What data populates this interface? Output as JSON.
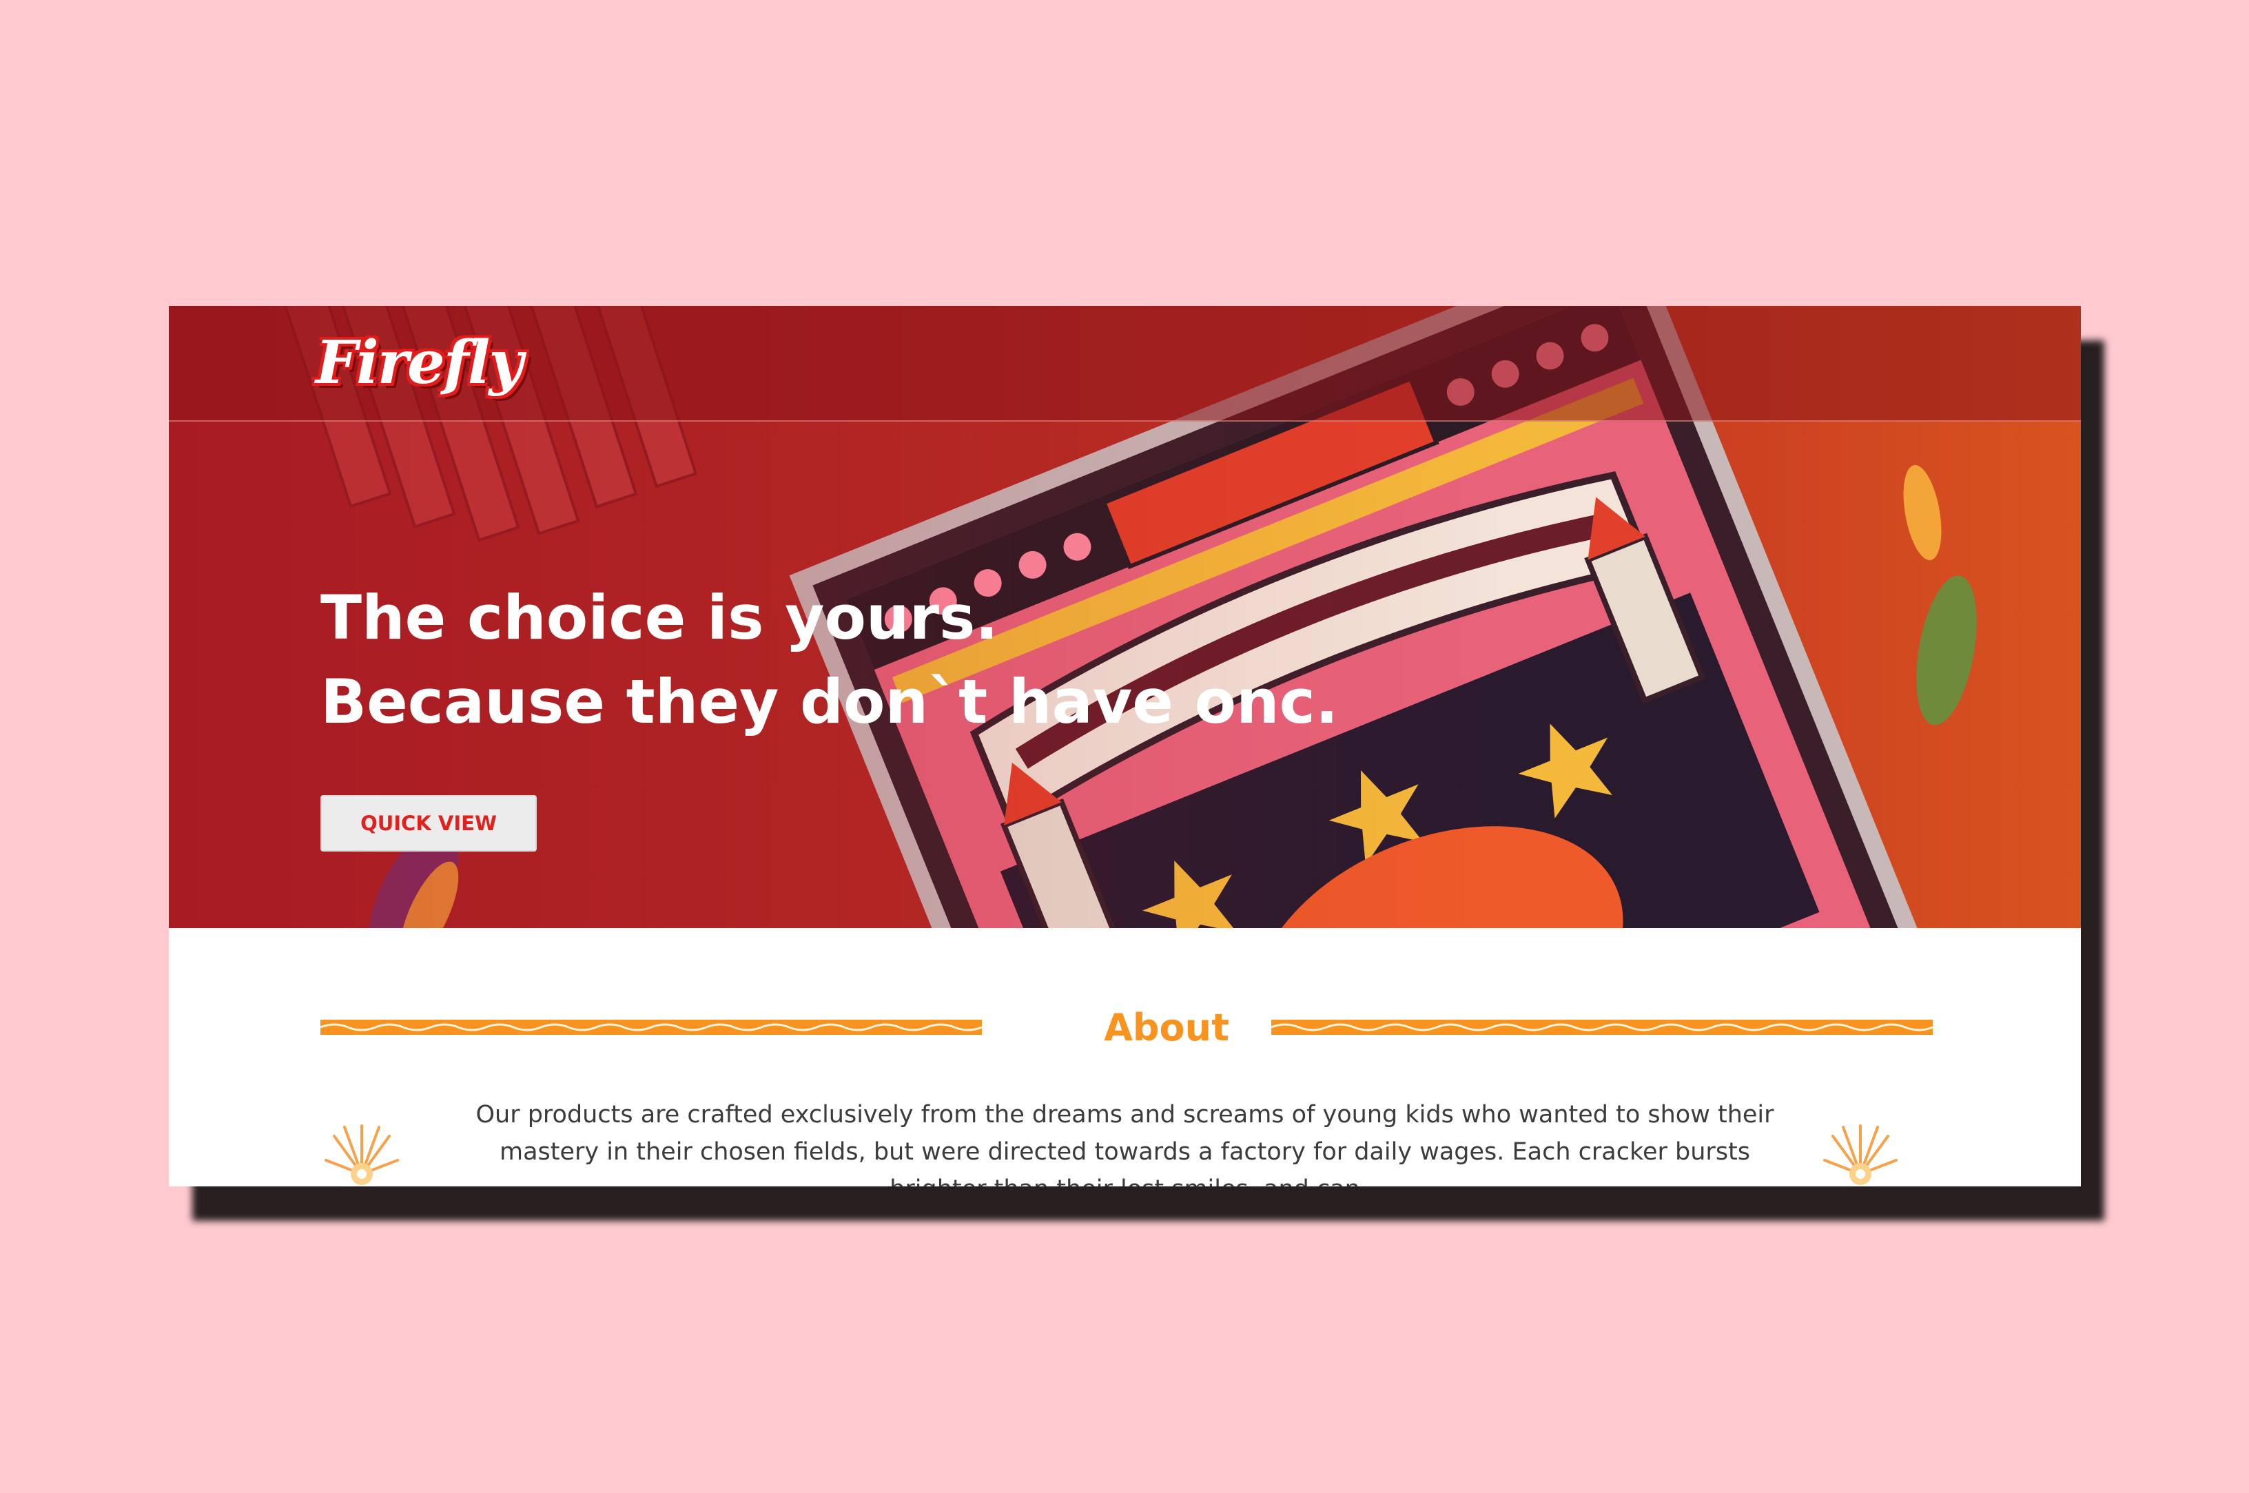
{
  "brand": {
    "logo_text": "Firefly"
  },
  "hero": {
    "headline_line1": "The choice is yours.",
    "headline_line2": "Because they don`t have onc.",
    "cta_label": "QUICK VIEW"
  },
  "about": {
    "heading": "About",
    "body": "Our products are crafted exclusively from the dreams and screams of young kids who wanted to show their mastery in their chosen fields, but were directed towards a factory for daily wages. Each cracker bursts brighter than their lost smiles, and can"
  },
  "colors": {
    "page_background": "#ffcbd1",
    "hero_red": "#b52a24",
    "accent_orange": "#f7931e",
    "cta_text": "#e0211d",
    "body_text": "#3c3c3c"
  },
  "icons": [
    "firework-burst-icon",
    "decorative-wave-divider"
  ]
}
